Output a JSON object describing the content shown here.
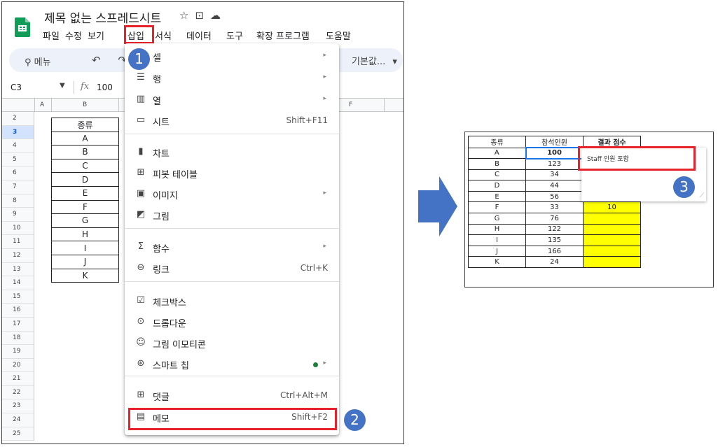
{
  "app": {
    "title": "제목 없는 스프레드시트",
    "title_icons": [
      "star-icon",
      "folder-move-icon",
      "cloud-icon"
    ],
    "menus": [
      "파일",
      "수정",
      "보기",
      "삽입",
      "서식",
      "데이터",
      "도구",
      "확장 프로그램",
      "도움말"
    ],
    "active_menu": "삽입"
  },
  "toolbar": {
    "search_label": "메뉴",
    "undo_redo": "↶ ↷",
    "font": "기본값...",
    "font_arrow": "▾"
  },
  "formula_bar": {
    "cell_ref": "C3",
    "fx": "fx",
    "value": "100"
  },
  "sheet": {
    "columns": [
      "A",
      "B",
      "F"
    ],
    "rows": [
      "2",
      "3",
      "4",
      "5",
      "6",
      "7",
      "8",
      "9",
      "10",
      "11",
      "12",
      "13",
      "14",
      "15",
      "16",
      "17",
      "18",
      "19",
      "20",
      "21",
      "22",
      "23",
      "24",
      "25"
    ],
    "active_row": "3",
    "table_header": "종류",
    "table_values": [
      "A",
      "B",
      "C",
      "D",
      "E",
      "F",
      "G",
      "H",
      "I",
      "J",
      "K"
    ]
  },
  "insert_menu": {
    "items": [
      {
        "icon": "cell-icon",
        "glyph": "▦",
        "label": "셀",
        "shortcut": "",
        "submenu": true
      },
      {
        "icon": "row-icon",
        "glyph": "☰",
        "label": "행",
        "shortcut": "",
        "submenu": true
      },
      {
        "icon": "column-icon",
        "glyph": "▥",
        "label": "열",
        "shortcut": "",
        "submenu": true
      },
      {
        "icon": "sheet-icon",
        "glyph": "▭",
        "label": "시트",
        "shortcut": "Shift+F11",
        "submenu": false
      },
      {
        "icon": "chart-icon",
        "glyph": "▮",
        "label": "차트",
        "shortcut": "",
        "submenu": false
      },
      {
        "icon": "pivot-table-icon",
        "glyph": "⊞",
        "label": "피봇 테이블",
        "shortcut": "",
        "submenu": false
      },
      {
        "icon": "image-icon",
        "glyph": "▣",
        "label": "이미지",
        "shortcut": "",
        "submenu": true
      },
      {
        "icon": "drawing-icon",
        "glyph": "◩",
        "label": "그림",
        "shortcut": "",
        "submenu": false
      },
      {
        "icon": "function-icon",
        "glyph": "Σ",
        "label": "함수",
        "shortcut": "",
        "submenu": true
      },
      {
        "icon": "link-icon",
        "glyph": "⊖",
        "label": "링크",
        "shortcut": "Ctrl+K",
        "submenu": false
      },
      {
        "icon": "checkbox-icon",
        "glyph": "☑",
        "label": "체크박스",
        "shortcut": "",
        "submenu": false
      },
      {
        "icon": "dropdown-icon",
        "glyph": "⊙",
        "label": "드롭다운",
        "shortcut": "",
        "submenu": false
      },
      {
        "icon": "emoji-icon",
        "glyph": "☺",
        "label": "그림 이모티콘",
        "shortcut": "",
        "submenu": false
      },
      {
        "icon": "smart-chip-icon",
        "glyph": "⊛",
        "label": "스마트 칩",
        "shortcut": "",
        "submenu": true
      },
      {
        "icon": "comment-icon",
        "glyph": "⊞",
        "label": "댓글",
        "shortcut": "Ctrl+Alt+M",
        "submenu": false
      },
      {
        "icon": "note-icon",
        "glyph": "▤",
        "label": "메모",
        "shortcut": "Shift+F2",
        "submenu": false
      }
    ],
    "submenu_arrow": "▸",
    "smart_chip_dot_color": "#188038"
  },
  "steps": [
    "1",
    "2",
    "3"
  ],
  "result": {
    "headers": [
      "종류",
      "참석인원",
      "결과 점수"
    ],
    "rows": [
      [
        "A",
        "100",
        ""
      ],
      [
        "B",
        "123",
        ""
      ],
      [
        "C",
        "34",
        ""
      ],
      [
        "D",
        "44",
        ""
      ],
      [
        "E",
        "56",
        ""
      ],
      [
        "F",
        "33",
        "10"
      ],
      [
        "G",
        "76",
        ""
      ],
      [
        "H",
        "122",
        ""
      ],
      [
        "I",
        "135",
        ""
      ],
      [
        "J",
        "166",
        ""
      ],
      [
        "K",
        "24",
        ""
      ]
    ],
    "note_text": "Staff 인원 포함",
    "highlight_color": "#ffff00"
  },
  "colors": {
    "accent_red": "#e8222a",
    "badge_blue": "#4472c4",
    "sheets_green": "#0f9d58"
  }
}
